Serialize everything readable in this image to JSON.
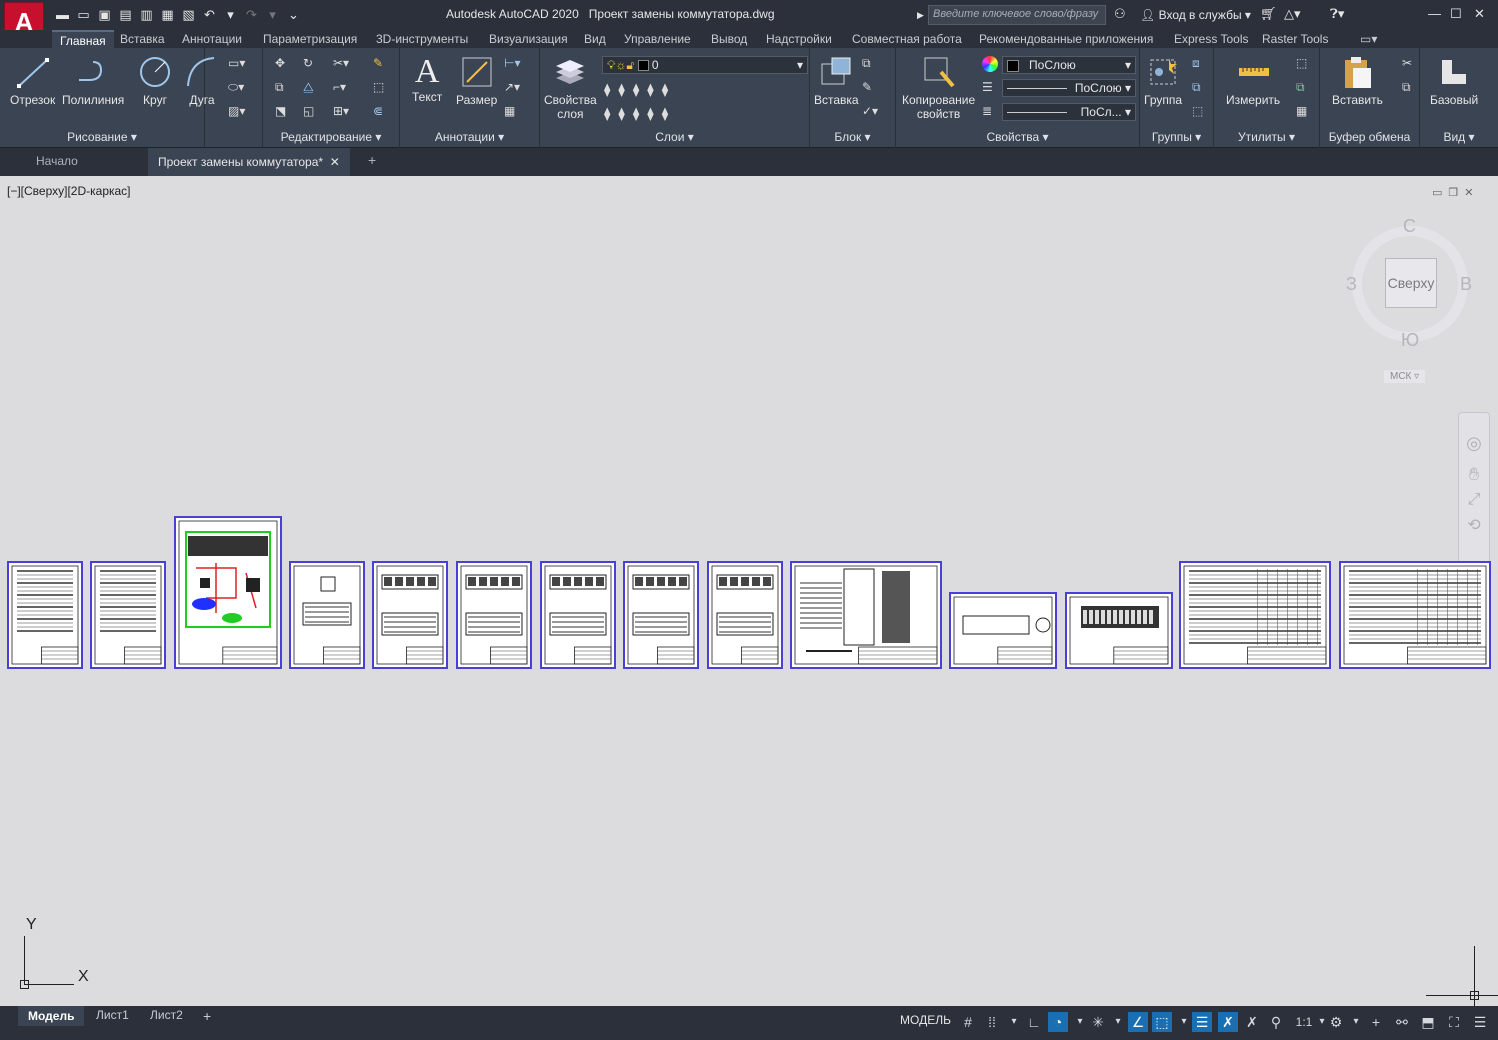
{
  "app": {
    "product": "Autodesk AutoCAD 2020",
    "file": "Проект замены коммутатора.dwg",
    "search_placeholder": "Введите ключевое слово/фразу",
    "signin": "Вход в службы"
  },
  "ribbon_tabs": [
    "Главная",
    "Вставка",
    "Аннотации",
    "Параметризация",
    "3D-инструменты",
    "Визуализация",
    "Вид",
    "Управление",
    "Вывод",
    "Надстройки",
    "Совместная работа",
    "Рекомендованные приложения",
    "Express Tools",
    "Raster Tools"
  ],
  "panels": {
    "draw": {
      "title": "Рисование",
      "line": "Отрезок",
      "polyline": "Полилиния",
      "circle": "Круг",
      "arc": "Дуга"
    },
    "modify": {
      "title": "Редактирование"
    },
    "annotation": {
      "title": "Аннотации",
      "text": "Текст",
      "dimension": "Размер"
    },
    "layers": {
      "title": "Слои",
      "layer_props_1": "Свойства",
      "layer_props_2": "слоя",
      "current_layer": "0"
    },
    "block": {
      "title": "Блок",
      "insert": "Вставка"
    },
    "properties": {
      "title": "Свойства",
      "match_1": "Копирование",
      "match_2": "свойств",
      "color": "ПоСлою",
      "linetype": "ПоСлою",
      "lineweight": "ПоСл..."
    },
    "groups": {
      "title": "Группы",
      "group": "Группа"
    },
    "utilities": {
      "title": "Утилиты",
      "measure": "Измерить"
    },
    "clipboard": {
      "title": "Буфер обмена",
      "paste": "Вставить"
    },
    "view": {
      "title": "Вид",
      "base": "Базовый"
    }
  },
  "doc_tabs": {
    "start": "Начало",
    "active": "Проект замены коммутатора*"
  },
  "viewport": {
    "label": "[−][Сверху][2D-каркас]",
    "viewcube": {
      "top": "Сверху",
      "n": "С",
      "s": "Ю",
      "w": "З",
      "e": "В",
      "ucs": "МСК"
    },
    "ucs_x": "X",
    "ucs_y": "Y"
  },
  "layout_tabs": [
    "Модель",
    "Лист1",
    "Лист2"
  ],
  "status": {
    "mode": "МОДЕЛЬ",
    "scale": "1:1"
  },
  "colors": {
    "accent": "#1a6fb3",
    "sheet_border": "#4a3fd6",
    "canvas": "#dcdcdf",
    "ribbon": "#3b4453"
  }
}
